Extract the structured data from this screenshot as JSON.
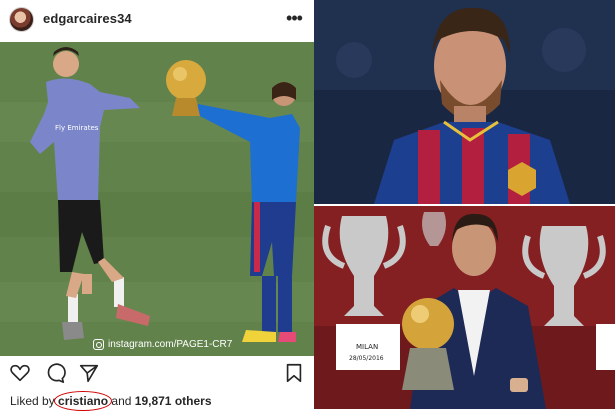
{
  "post": {
    "username": "edgarcaires34",
    "more_label": "•••",
    "watermark": "instagram.com/PAGE1-CR7",
    "liked_prefix": "Liked by",
    "liked_user": "cristiano",
    "liked_and": "and",
    "liked_count": "19,871 others",
    "shirt_text": "Fly Emirates"
  },
  "icons": [
    "more-icon",
    "heart-icon",
    "comment-icon",
    "share-icon",
    "bookmark-icon",
    "instagram-glyph-icon"
  ],
  "photos": {
    "trophy_plaque": "MILAN",
    "trophy_date": "28/05/2016"
  },
  "colors": {
    "annotation_circle": "#d10000",
    "text": "#262626"
  }
}
